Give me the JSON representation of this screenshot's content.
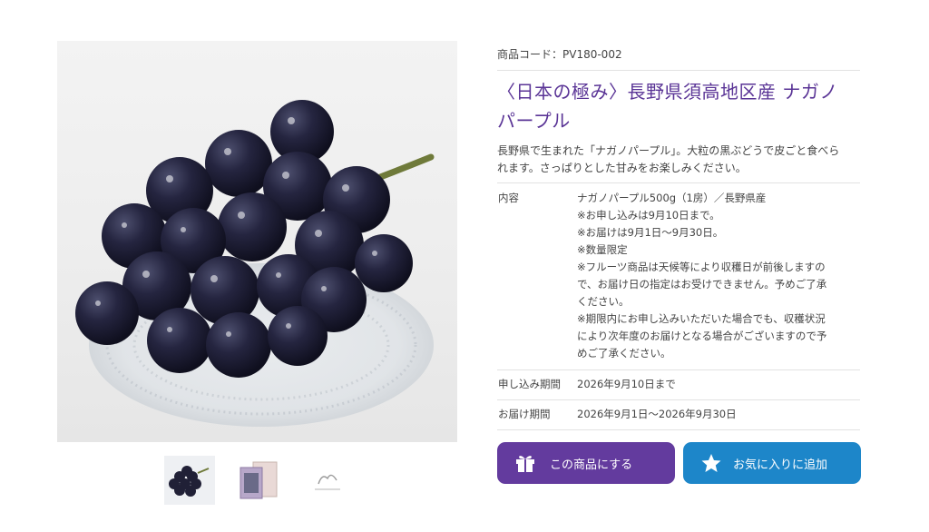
{
  "product": {
    "code": "商品コード：PV180-002",
    "title_line1": "〈日本の極み〉長野県須高地区産 ナガノ",
    "title_line2": "パープル",
    "lead_line1": "長野県で生まれた「ナガノパープル」。大粒の黒ぶどうで皮ごと食べら",
    "lead_line2": "れます。さっぱりとした甘みをお楽しみください。"
  },
  "spec": {
    "content_label": "内容",
    "content_lines": [
      "ナガノパープル500g（1房）／長野県産",
      "※お申し込みは9月10日まで。",
      "※お届けは9月1日〜9月30日。",
      "※数量限定"
    ],
    "content_note1_lines": [
      "※フルーツ商品は天候等により収穫日が前後しますの",
      "で、お届け日の指定はお受けできません。予めご了承",
      "ください。"
    ],
    "content_note2_lines": [
      "※期限内にお申し込みいただいた場合でも、収穫状況",
      "により次年度のお届けとなる場合がございますので予",
      "めご了承ください。"
    ],
    "period_label": "申し込み期間",
    "period_value": "2026年9月10日まで",
    "delivery_label": "お届け期間",
    "delivery_value": "2026年9月1日〜2026年9月30日"
  },
  "buttons": {
    "cart_label": "この商品にする",
    "cart_icon": "gift-icon",
    "favorite_label": "お気に入りに追加",
    "favorite_icon": "star-icon"
  },
  "colors": {
    "title": "#5a3496",
    "cart_button": "#633b9e",
    "favorite_button": "#1d86c9"
  }
}
